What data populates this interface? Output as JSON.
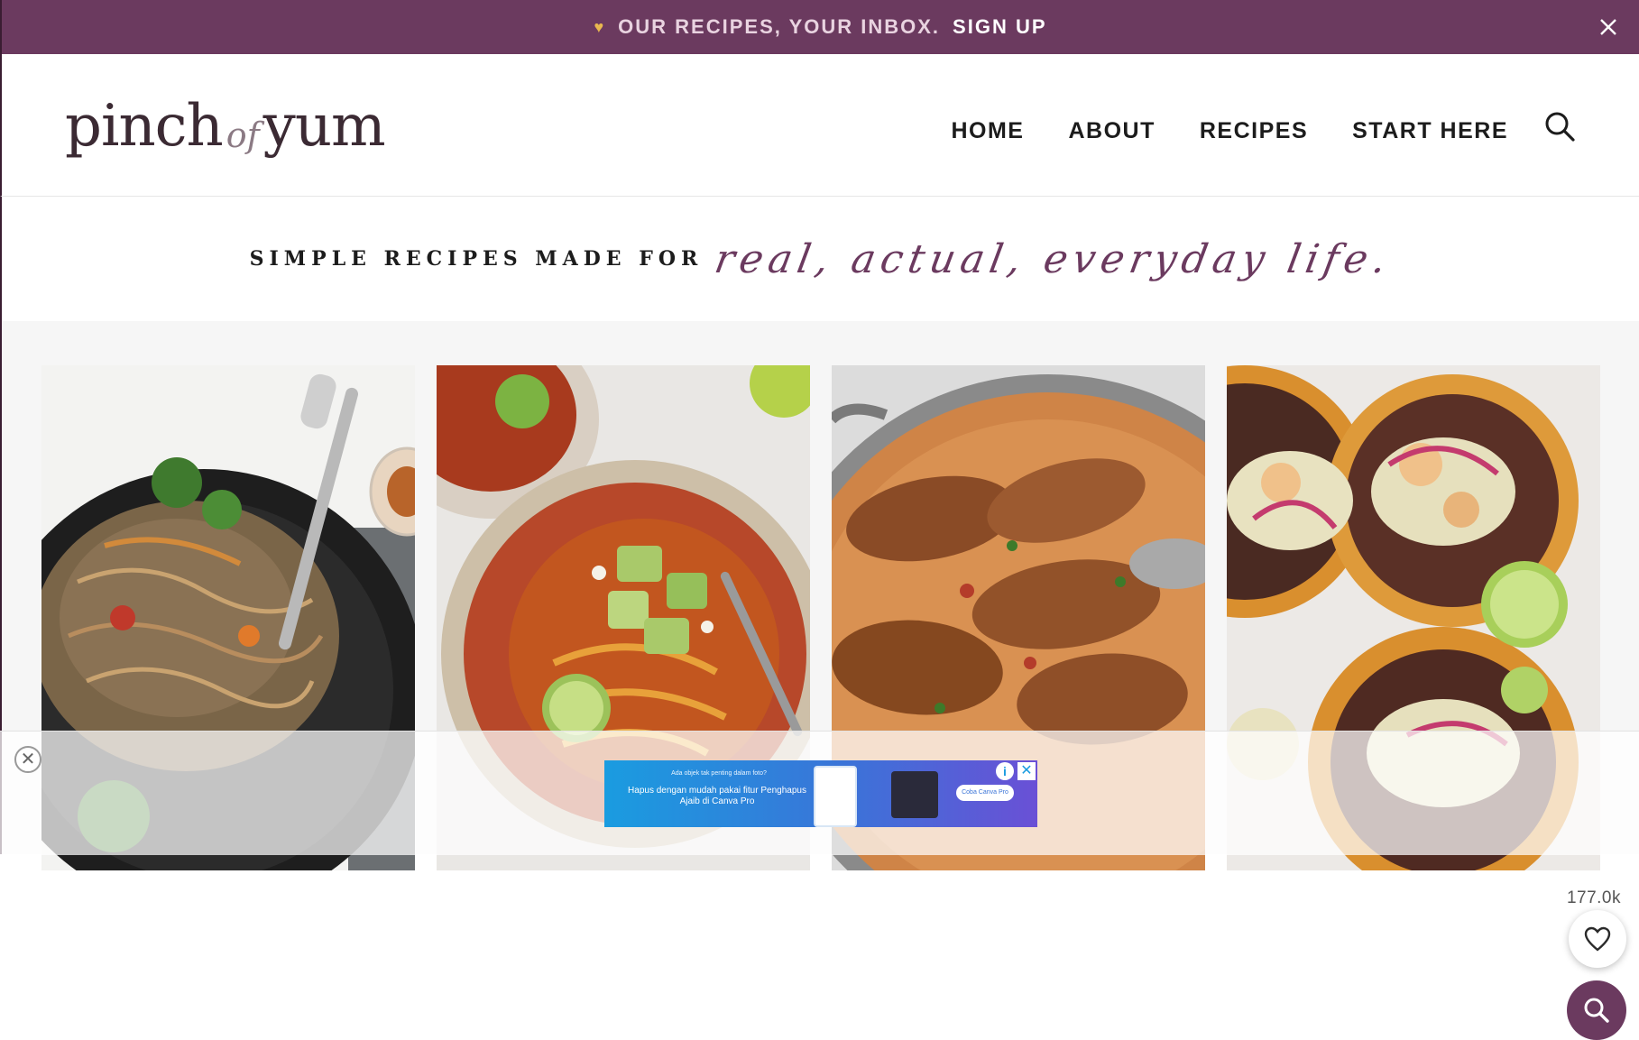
{
  "promo": {
    "text": "OUR RECIPES, YOUR INBOX.",
    "link": "SIGN UP",
    "close_icon": "close-icon",
    "colors": {
      "background": "#6b3a5f",
      "heart": "#e9b84f"
    }
  },
  "header": {
    "logo": {
      "part1": "pinch",
      "part2": "of",
      "part3": "yum"
    },
    "nav": [
      {
        "label": "HOME"
      },
      {
        "label": "ABOUT"
      },
      {
        "label": "RECIPES"
      },
      {
        "label": "START HERE"
      }
    ],
    "search_icon": "search-icon"
  },
  "tagline": {
    "lead": "SIMPLE RECIPES MADE FOR",
    "script": "real, actual, everyday life."
  },
  "recipes": [
    {
      "name": "noodle-bowl"
    },
    {
      "name": "tortilla-soup"
    },
    {
      "name": "creamy-chicken-skillet"
    },
    {
      "name": "cauliflower-tostadas"
    }
  ],
  "floating": {
    "favorites_count": "177.0k",
    "heart_icon": "heart-icon",
    "search_icon": "search-icon"
  },
  "ad": {
    "close_symbol": "✕",
    "line1": "Ada objek tak penting dalam foto?",
    "line2": "Hapus dengan mudah pakai fitur Penghapus Ajaib di Canva Pro",
    "cta": "Coba Canva Pro",
    "info_symbol": "i",
    "x_symbol": "✕"
  }
}
